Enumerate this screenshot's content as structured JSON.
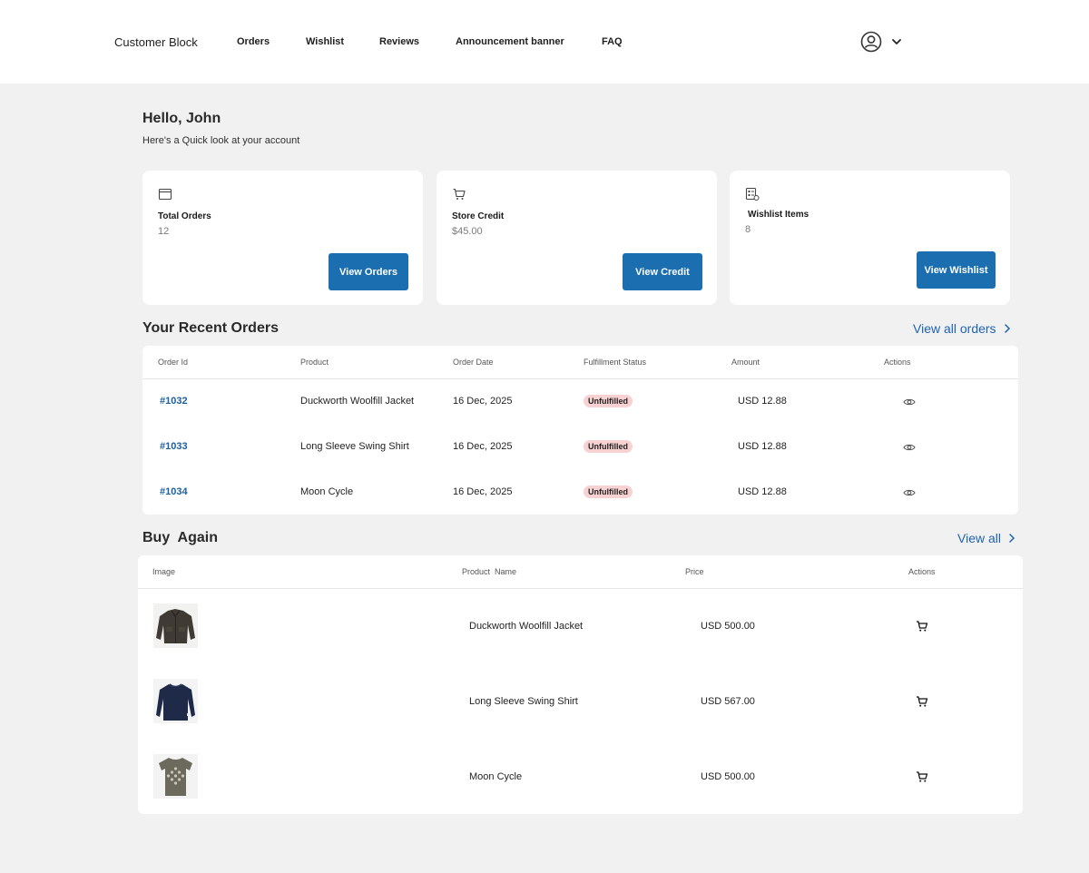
{
  "header": {
    "brand": "Customer Block",
    "nav": [
      "Orders",
      "Wishlist",
      "Reviews",
      "Announcement banner",
      "FAQ"
    ]
  },
  "greeting": {
    "title": "Hello, John",
    "subtitle": "Here's a Quick look at your account"
  },
  "cards": [
    {
      "icon": "box-icon",
      "label": "Total Orders",
      "value": "12",
      "button": "View Orders"
    },
    {
      "icon": "cart-icon",
      "label": "Store Credit",
      "value": "$45.00",
      "button": "View Credit"
    },
    {
      "icon": "list-icon",
      "label": "Wishlist Items",
      "value": "8",
      "button": "View Wishlist"
    }
  ],
  "recent_orders": {
    "title": "Your Recent Orders",
    "view_all": "View all orders",
    "columns": [
      "Order Id",
      "Product",
      "Order Date",
      "Fulfillment Status",
      "Amount",
      "Actions"
    ],
    "rows": [
      {
        "id": "#1032",
        "product": "Duckworth Woolfill Jacket",
        "date": "16 Dec, 2025",
        "status": "Unfulfilled",
        "amount": "USD 12.88"
      },
      {
        "id": "#1033",
        "product": "Long Sleeve Swing Shirt",
        "date": "16 Dec, 2025",
        "status": "Unfulfilled",
        "amount": "USD 12.88"
      },
      {
        "id": "#1034",
        "product": "Moon Cycle",
        "date": "16 Dec, 2025",
        "status": "Unfulfilled",
        "amount": "USD 12.88"
      }
    ]
  },
  "buy_again": {
    "title": "Buy  Again",
    "view_all": "View all",
    "columns": [
      "Image",
      "Product  Name",
      "Price",
      "Actions"
    ],
    "rows": [
      {
        "name": "Duckworth Woolfill Jacket",
        "price": "USD 500.00",
        "image": "jacket-image"
      },
      {
        "name": "Long Sleeve Swing Shirt",
        "price": "USD 567.00",
        "image": "shirt-image"
      },
      {
        "name": "Moon Cycle",
        "price": "USD 500.00",
        "image": "tshirt-image"
      }
    ]
  },
  "colors": {
    "accent": "#1b6fb0",
    "link": "#1e63b0",
    "badge_bg": "#f8d2d2",
    "page_bg": "#f1f1f1"
  }
}
